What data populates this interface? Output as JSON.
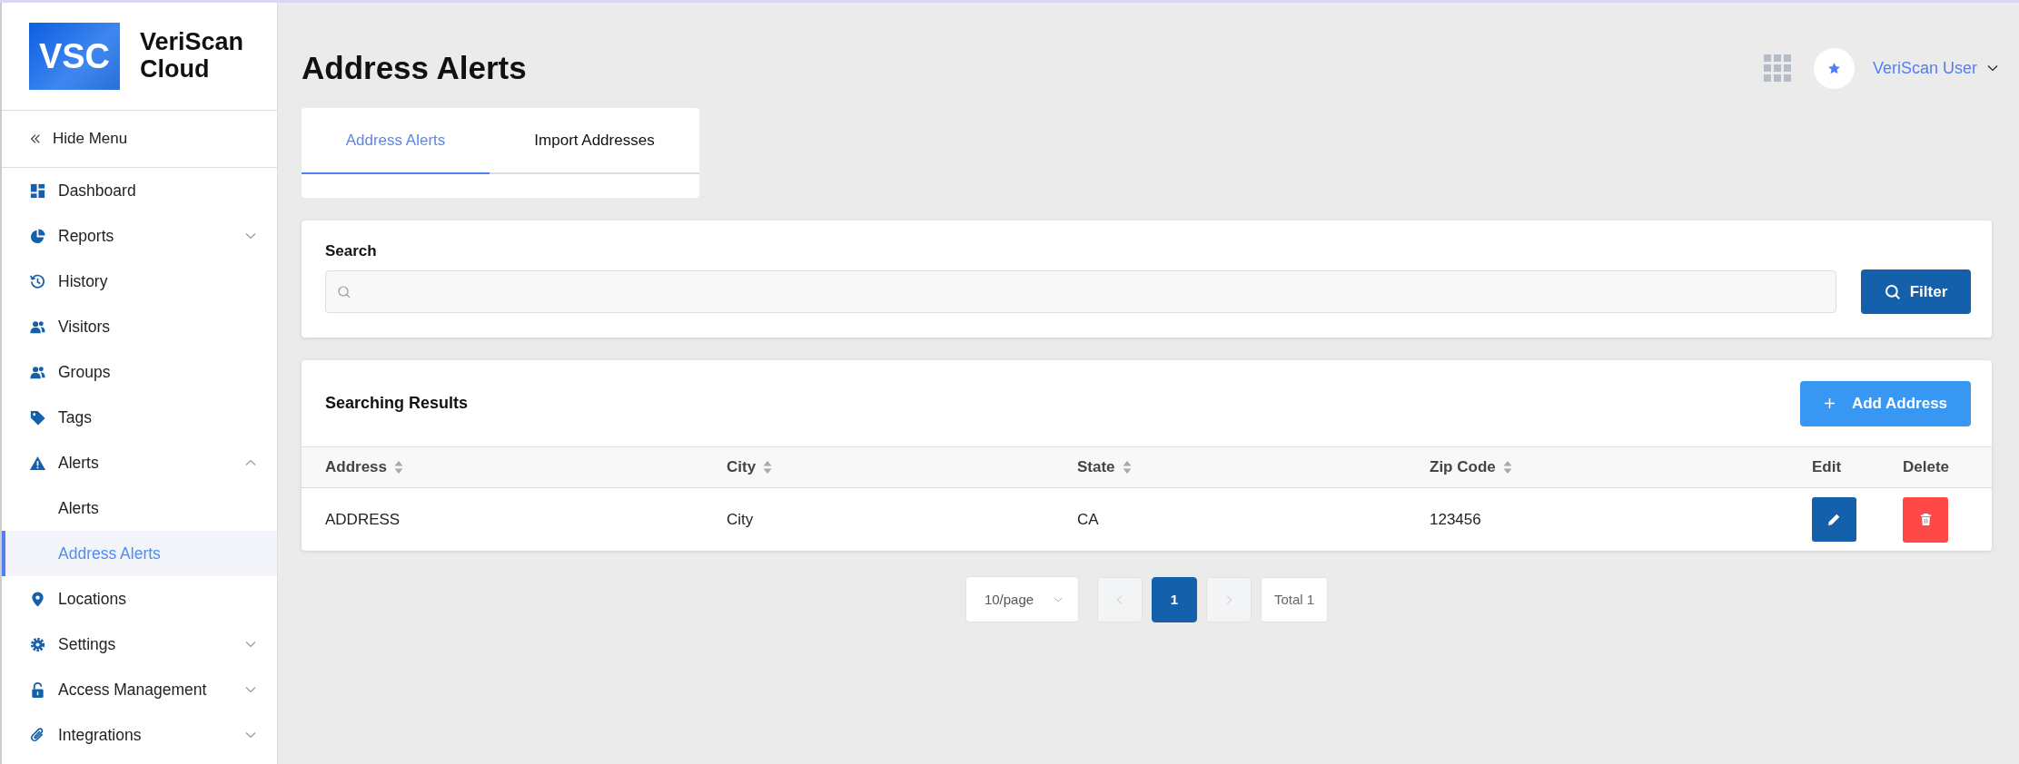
{
  "logo": {
    "badge": "VSC",
    "name": "VeriScan Cloud"
  },
  "hide_menu": {
    "label": "Hide Menu"
  },
  "sidebar": {
    "items": [
      {
        "label": "Dashboard",
        "selected": false
      },
      {
        "label": "Reports",
        "selected": false,
        "expanded": false
      },
      {
        "label": "History",
        "selected": false
      },
      {
        "label": "Visitors",
        "selected": false
      },
      {
        "label": "Groups",
        "selected": false
      },
      {
        "label": "Tags",
        "selected": false
      },
      {
        "label": "Alerts",
        "selected": false,
        "expanded": true,
        "children": [
          {
            "label": "Alerts",
            "selected": false
          },
          {
            "label": "Address Alerts",
            "selected": true
          }
        ]
      },
      {
        "label": "Locations",
        "selected": false
      },
      {
        "label": "Settings",
        "selected": false,
        "expanded": false
      },
      {
        "label": "Access Management",
        "selected": false,
        "expanded": false
      },
      {
        "label": "Integrations",
        "selected": false,
        "expanded": false
      }
    ]
  },
  "page_title": "Address Alerts",
  "user": {
    "name": "VeriScan User"
  },
  "tabs": [
    {
      "label": "Address Alerts",
      "selected": true
    },
    {
      "label": "Import Addresses",
      "selected": false
    }
  ],
  "search": {
    "label": "Search",
    "button": "Filter"
  },
  "results": {
    "title": "Searching Results",
    "add_button": "Add Address",
    "columns": [
      {
        "label": "Address",
        "sortable": true
      },
      {
        "label": "City",
        "sortable": true
      },
      {
        "label": "State",
        "sortable": true
      },
      {
        "label": "Zip Code",
        "sortable": true
      },
      {
        "label": "Edit",
        "sortable": false
      },
      {
        "label": "Delete",
        "sortable": false
      }
    ],
    "rows": [
      {
        "cells": [
          "ADDRESS",
          "City",
          "CA",
          "123456"
        ]
      }
    ]
  },
  "pagination": {
    "page_size": "10/page",
    "pages": [
      {
        "label": "1",
        "selected": true
      }
    ],
    "total": "Total 1"
  }
}
